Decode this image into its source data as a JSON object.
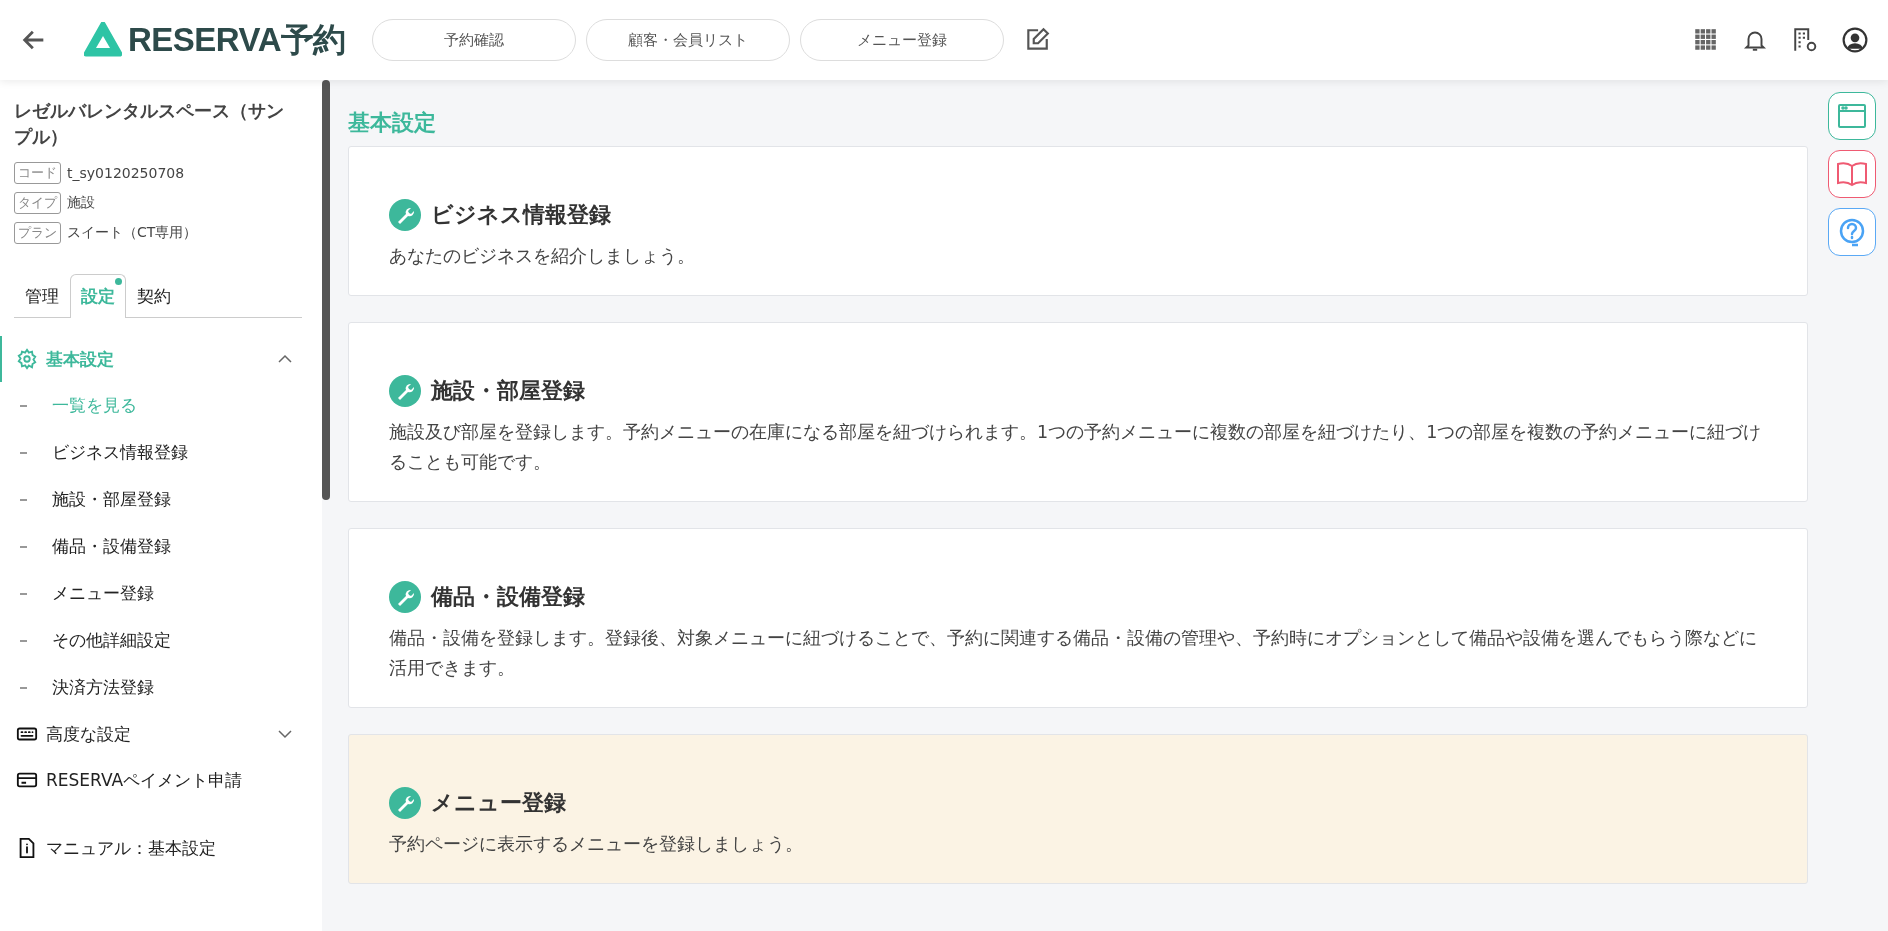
{
  "header": {
    "logo": "RESERVA予約",
    "nav": [
      "予約確認",
      "顧客・会員リスト",
      "メニュー登録"
    ]
  },
  "sidebar": {
    "title": "レゼルバレンタルスペース（サンプル）",
    "meta": [
      {
        "tag": "コード",
        "value": "t_sy0120250708"
      },
      {
        "tag": "タイプ",
        "value": "施設"
      },
      {
        "tag": "プラン",
        "value": "スイート（CT専用）"
      }
    ],
    "tabs": [
      {
        "label": "管理",
        "selected": false,
        "dot": false
      },
      {
        "label": "設定",
        "selected": true,
        "dot": true
      },
      {
        "label": "契約",
        "selected": false,
        "dot": false
      }
    ],
    "menu": [
      {
        "kind": "section",
        "label": "基本設定",
        "expanded": true,
        "children": [
          {
            "label": "一覧を見る",
            "selected": true
          },
          {
            "label": "ビジネス情報登録",
            "selected": false
          },
          {
            "label": "施設・部屋登録",
            "selected": false
          },
          {
            "label": "備品・設備登録",
            "selected": false
          },
          {
            "label": "メニュー登録",
            "selected": false
          },
          {
            "label": "その他詳細設定",
            "selected": false
          },
          {
            "label": "決済方法登録",
            "selected": false
          }
        ]
      },
      {
        "kind": "section",
        "label": "高度な設定",
        "expanded": false
      },
      {
        "kind": "link",
        "label": "RESERVAペイメント申請"
      },
      {
        "kind": "manual",
        "label": "マニュアル：基本設定"
      }
    ]
  },
  "main": {
    "title": "基本設定",
    "cards": [
      {
        "title": "ビジネス情報登録",
        "description": "あなたのビジネスを紹介しましょう。",
        "highlighted": false
      },
      {
        "title": "施設・部屋登録",
        "description": "施設及び部屋を登録します。予約メニューの在庫になる部屋を紐づけられます。1つの予約メニューに複数の部屋を紐づけたり、1つの部屋を複数の予約メニューに紐づけることも可能です。",
        "highlighted": false
      },
      {
        "title": "備品・設備登録",
        "description": "備品・設備を登録します。登録後、対象メニューに紐づけることで、予約に関連する備品・設備の管理や、予約時にオプションとして備品や設備を選んでもらう際などに活用できます。",
        "highlighted": false
      },
      {
        "title": "メニュー登録",
        "description": "予約ページに表示するメニューを登録しましょう。",
        "highlighted": true
      }
    ]
  }
}
